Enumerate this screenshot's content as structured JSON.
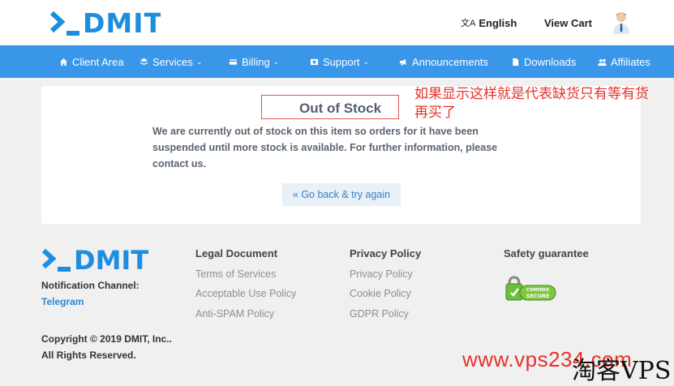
{
  "header": {
    "logo_text": "DMIT",
    "language_label": "English",
    "language_icon": "translate-icon",
    "view_cart_label": "View Cart"
  },
  "nav": {
    "items": [
      {
        "label": "Client Area",
        "icon": "home-icon"
      },
      {
        "label": "Services",
        "icon": "stack-icon",
        "caret": "⌄"
      },
      {
        "label": "Billing",
        "icon": "credit-card-icon",
        "caret": "⌄"
      },
      {
        "label": "Support",
        "icon": "ticket-icon",
        "caret": "⌄"
      },
      {
        "label": "Announcements",
        "icon": "megaphone-icon"
      },
      {
        "label": "Downloads",
        "icon": "file-icon"
      },
      {
        "label": "Affiliates",
        "icon": "users-icon"
      }
    ]
  },
  "main": {
    "title": "Out of Stock",
    "message": "We are currently out of stock on this item so orders for it have been suspended until more stock is available. For further information, please contact us.",
    "back_button": "« Go back & try again",
    "annotation_note": "如果显示这样就是代表缺货只有等有货再买了"
  },
  "footer": {
    "logo_text": "DMIT",
    "notification_label": "Notification Channel:",
    "notification_link": "Telegram",
    "copyright_line1": "Copyright © 2019 DMIT, Inc..",
    "copyright_line2": "All Rights Reserved.",
    "legal": {
      "heading": "Legal Document",
      "links": [
        "Terms of Services",
        "Acceptable Use Policy",
        "Anti-SPAM Policy"
      ]
    },
    "privacy": {
      "heading": "Privacy Policy",
      "links": [
        "Privacy Policy",
        "Cookie Policy",
        "GDPR Policy"
      ]
    },
    "safety": {
      "heading": "Safety guarantee",
      "seal_text": "COMODO SECURE"
    }
  },
  "watermark": {
    "url": "www.vps234.com",
    "brand": "淘客VPS"
  },
  "colors": {
    "brand_blue": "#1c8ee0",
    "nav_blue": "#3a96e8",
    "annotation_red": "#e8322a"
  }
}
